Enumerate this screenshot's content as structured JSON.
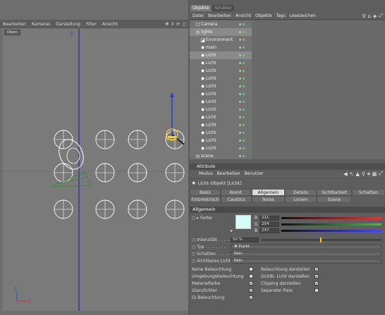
{
  "viewport": {
    "menu": [
      "Bearbeiten",
      "Kameras",
      "Darstellung",
      "Filter",
      "Ansicht"
    ],
    "nav_icons": [
      "move-icon",
      "zoom-icon",
      "rotate-icon",
      "maximize-icon"
    ],
    "view_label": "Oben",
    "axis_labels": {
      "z_top": "Z",
      "x_axis": "X",
      "z_axis": "Z"
    }
  },
  "object_manager": {
    "tabs": [
      "Objekte",
      "Struktur"
    ],
    "menu": [
      "Datei",
      "Bearbeiten",
      "Ansicht",
      "Objekte",
      "Tags",
      "Lesezeichen"
    ],
    "items": [
      {
        "label": "Camera",
        "icon": "camera-icon",
        "indent": 1
      },
      {
        "label": "lights",
        "icon": "null-icon",
        "indent": 1,
        "selected": true
      },
      {
        "label": "Environment",
        "icon": "environment-icon",
        "indent": 2
      },
      {
        "label": "main",
        "icon": "light-icon",
        "indent": 2
      },
      {
        "label": "Licht",
        "icon": "light-icon",
        "indent": 2,
        "selected": true
      },
      {
        "label": "Licht",
        "icon": "light-icon",
        "indent": 2
      },
      {
        "label": "Licht",
        "icon": "light-icon",
        "indent": 2
      },
      {
        "label": "Licht",
        "icon": "light-icon",
        "indent": 2
      },
      {
        "label": "Licht",
        "icon": "light-icon",
        "indent": 2
      },
      {
        "label": "Licht",
        "icon": "light-icon",
        "indent": 2
      },
      {
        "label": "Licht",
        "icon": "light-icon",
        "indent": 2
      },
      {
        "label": "Licht",
        "icon": "light-icon",
        "indent": 2
      },
      {
        "label": "Licht",
        "icon": "light-icon",
        "indent": 2
      },
      {
        "label": "Licht",
        "icon": "light-icon",
        "indent": 2
      },
      {
        "label": "Licht",
        "icon": "light-icon",
        "indent": 2
      },
      {
        "label": "Licht",
        "icon": "light-icon",
        "indent": 2
      },
      {
        "label": "Licht",
        "icon": "light-icon",
        "indent": 2
      },
      {
        "label": "scene",
        "icon": "null-icon",
        "indent": 1
      }
    ]
  },
  "attributes": {
    "title": "Attribute",
    "menu": [
      "Modus",
      "Bearbeiten",
      "Benutzer"
    ],
    "object_title": "Licht-Objekt [Licht]",
    "tabs_row1": [
      "Basis",
      "Koord.",
      "Allgemein",
      "Details",
      "Sichtbarkeit",
      "Schatten"
    ],
    "tabs_row2": [
      "Fotometrisch",
      "Caustics",
      "Noise",
      "Linsen",
      "Szene"
    ],
    "active_tab": "Allgemein",
    "section": "Allgemein",
    "farbe_label": "Farbe",
    "r_label": "R",
    "r_value": "211",
    "g_label": "G",
    "g_value": "254",
    "b_label": "B",
    "b_value": "247",
    "swatch_color": "#d3fef7",
    "intensitaet_label": "Intensität",
    "intensitaet_value": "50 %",
    "typ_label": "Typ",
    "typ_value": "Punkt",
    "schatten_label": "Schatten",
    "schatten_value": "Kein",
    "sichtbar_label": "Sichtbares Licht",
    "sichtbar_value": "Kein",
    "checks_left": [
      {
        "label": "Keine Beleuchtung",
        "checked": false
      },
      {
        "label": "Umgebungsbeleuchtung",
        "checked": false
      },
      {
        "label": "Materialfarbe",
        "checked": true
      },
      {
        "label": "Glanzlichter",
        "checked": true
      },
      {
        "label": "GI Beleuchtung",
        "checked": true
      }
    ],
    "checks_right": [
      {
        "label": "Beleuchtung darstellen",
        "checked": true
      },
      {
        "label": "Sichtb. Licht darstellen",
        "checked": true
      },
      {
        "label": "Clipping darstellen",
        "checked": true
      },
      {
        "label": "Separater Pass",
        "checked": false
      }
    ]
  }
}
